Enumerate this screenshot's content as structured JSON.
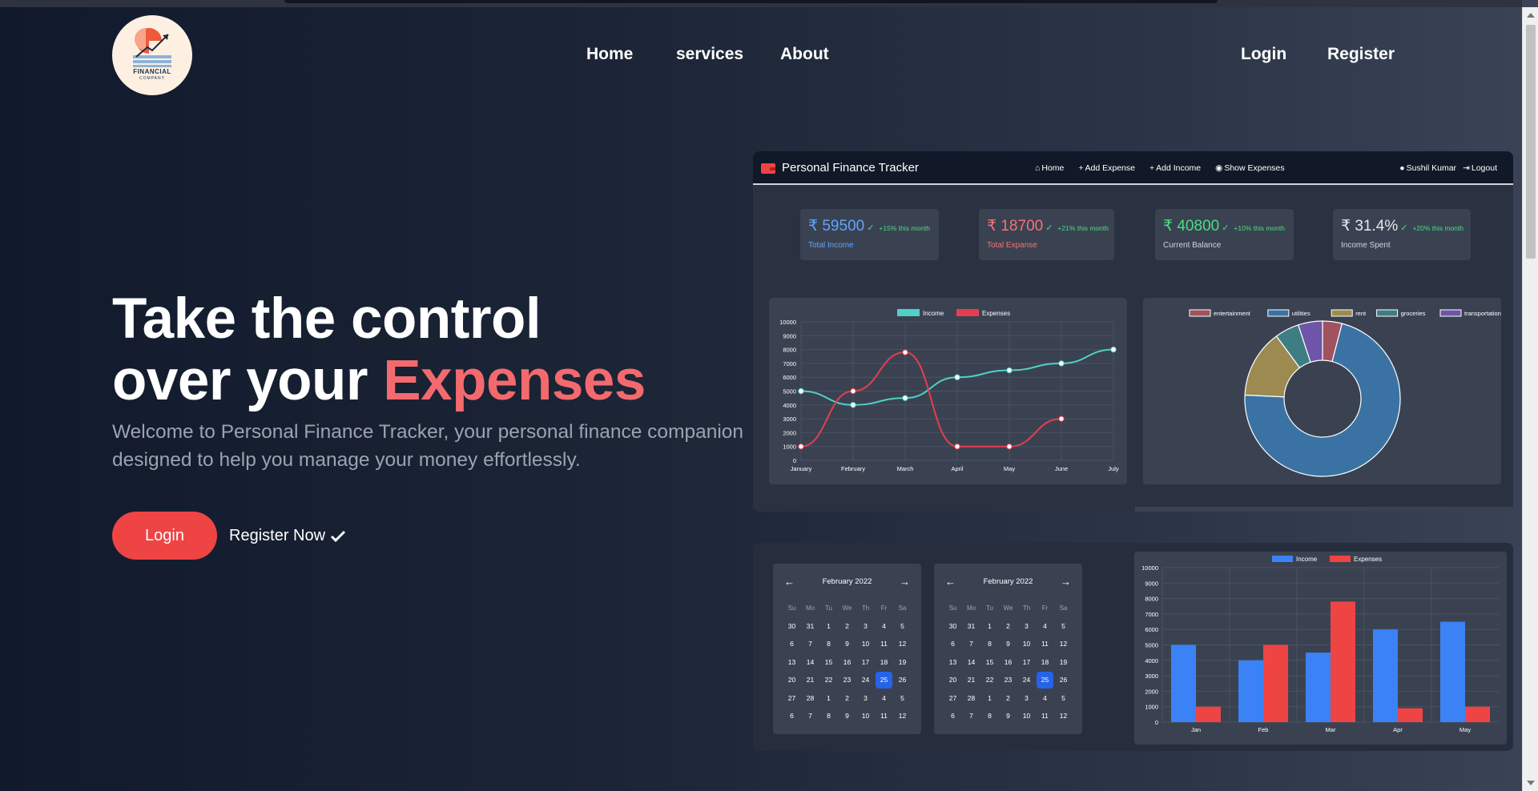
{
  "header": {
    "logo_text": "FINANCIAL",
    "logo_subtext": "COMPANY",
    "nav": [
      "Home",
      "services",
      "About"
    ],
    "login": "Login",
    "register": "Register"
  },
  "hero": {
    "title_line1": "Take the control",
    "title_line2_prefix": "over your ",
    "title_line2_accent": "Expenses",
    "subtitle": "Welcome to Personal Finance Tracker, your personal finance companion designed to help you manage your money effortlessly.",
    "login_button": "Login",
    "register_button": "Register Now"
  },
  "dashboard": {
    "brand": "Personal Finance Tracker",
    "links": [
      "Home",
      "Add Expense",
      "Add Income",
      "Show Expenses"
    ],
    "user": "Sushil Kumar",
    "logout": "Logout",
    "stats": [
      {
        "value": "₹ 59500",
        "change": "+15% this month",
        "label": "Total Income",
        "color": "#60a5fa",
        "label_color": "#60a5fa"
      },
      {
        "value": "₹ 18700",
        "change": "+21% this month",
        "label": "Total Expanse",
        "color": "#f87171",
        "label_color": "#f87171"
      },
      {
        "value": "₹ 40800",
        "change": "+10% this month",
        "label": "Current Balance",
        "color": "#4ade80",
        "label_color": "#d1d5db"
      },
      {
        "value": "₹ 31.4%",
        "change": "+20% this month",
        "label": "Income Spent",
        "color": "#e5e7eb",
        "label_color": "#d1d5db"
      }
    ]
  },
  "calendars": [
    {
      "month": "February 2022",
      "days_of_week": [
        "Su",
        "Mo",
        "Tu",
        "We",
        "Th",
        "Fr",
        "Sa"
      ],
      "weeks": [
        [
          "30",
          "31",
          "1",
          "2",
          "3",
          "4",
          "5"
        ],
        [
          "6",
          "7",
          "8",
          "9",
          "10",
          "11",
          "12"
        ],
        [
          "13",
          "14",
          "15",
          "16",
          "17",
          "18",
          "19"
        ],
        [
          "20",
          "21",
          "22",
          "23",
          "24",
          "25",
          "26"
        ],
        [
          "27",
          "28",
          "1",
          "2",
          "3",
          "4",
          "5"
        ],
        [
          "6",
          "7",
          "8",
          "9",
          "10",
          "11",
          "12"
        ]
      ],
      "selected": "25"
    },
    {
      "month": "February 2022",
      "days_of_week": [
        "Su",
        "Mo",
        "Tu",
        "We",
        "Th",
        "Fr",
        "Sa"
      ],
      "weeks": [
        [
          "30",
          "31",
          "1",
          "2",
          "3",
          "4",
          "5"
        ],
        [
          "6",
          "7",
          "8",
          "9",
          "10",
          "11",
          "12"
        ],
        [
          "13",
          "14",
          "15",
          "16",
          "17",
          "18",
          "19"
        ],
        [
          "20",
          "21",
          "22",
          "23",
          "24",
          "25",
          "26"
        ],
        [
          "27",
          "28",
          "1",
          "2",
          "3",
          "4",
          "5"
        ],
        [
          "6",
          "7",
          "8",
          "9",
          "10",
          "11",
          "12"
        ]
      ],
      "selected": "25"
    }
  ],
  "chart_data": [
    {
      "type": "line",
      "categories": [
        "January",
        "February",
        "March",
        "April",
        "May",
        "June",
        "July"
      ],
      "series": [
        {
          "name": "Income",
          "color": "#4fd1c5",
          "values": [
            5000,
            4000,
            4500,
            6000,
            6500,
            7000,
            8000
          ]
        },
        {
          "name": "Expenses",
          "color": "#e53e4e",
          "values": [
            1000,
            5000,
            7800,
            1000,
            1000,
            3000,
            null
          ]
        }
      ],
      "ylim": [
        0,
        10000
      ],
      "yticks": [
        0,
        1000,
        2000,
        3000,
        4000,
        5000,
        6000,
        7000,
        8000,
        9000,
        10000
      ],
      "legend": "top-center",
      "grid": true
    },
    {
      "type": "pie",
      "donut": true,
      "labels": [
        "entertainment",
        "utilities",
        "rent",
        "groceries",
        "transportation"
      ],
      "colors": [
        "#a0525f",
        "#3a73a3",
        "#9c8a50",
        "#3e7d84",
        "#6e55a8"
      ],
      "values": [
        4,
        71,
        14,
        5,
        5
      ],
      "legend": "top-center"
    },
    {
      "type": "bar",
      "categories": [
        "Jan",
        "Feb",
        "Mar",
        "Apr",
        "May"
      ],
      "series": [
        {
          "name": "Income",
          "color": "#3b82f6",
          "values": [
            5000,
            4000,
            4500,
            6000,
            6500
          ]
        },
        {
          "name": "Expenses",
          "color": "#ef4444",
          "values": [
            1000,
            5000,
            7800,
            900,
            1000
          ]
        }
      ],
      "ylim": [
        0,
        10000
      ],
      "yticks": [
        0,
        1000,
        2000,
        3000,
        4000,
        5000,
        6000,
        7000,
        8000,
        9000,
        10000
      ],
      "legend": "top-center",
      "grid": true
    }
  ]
}
